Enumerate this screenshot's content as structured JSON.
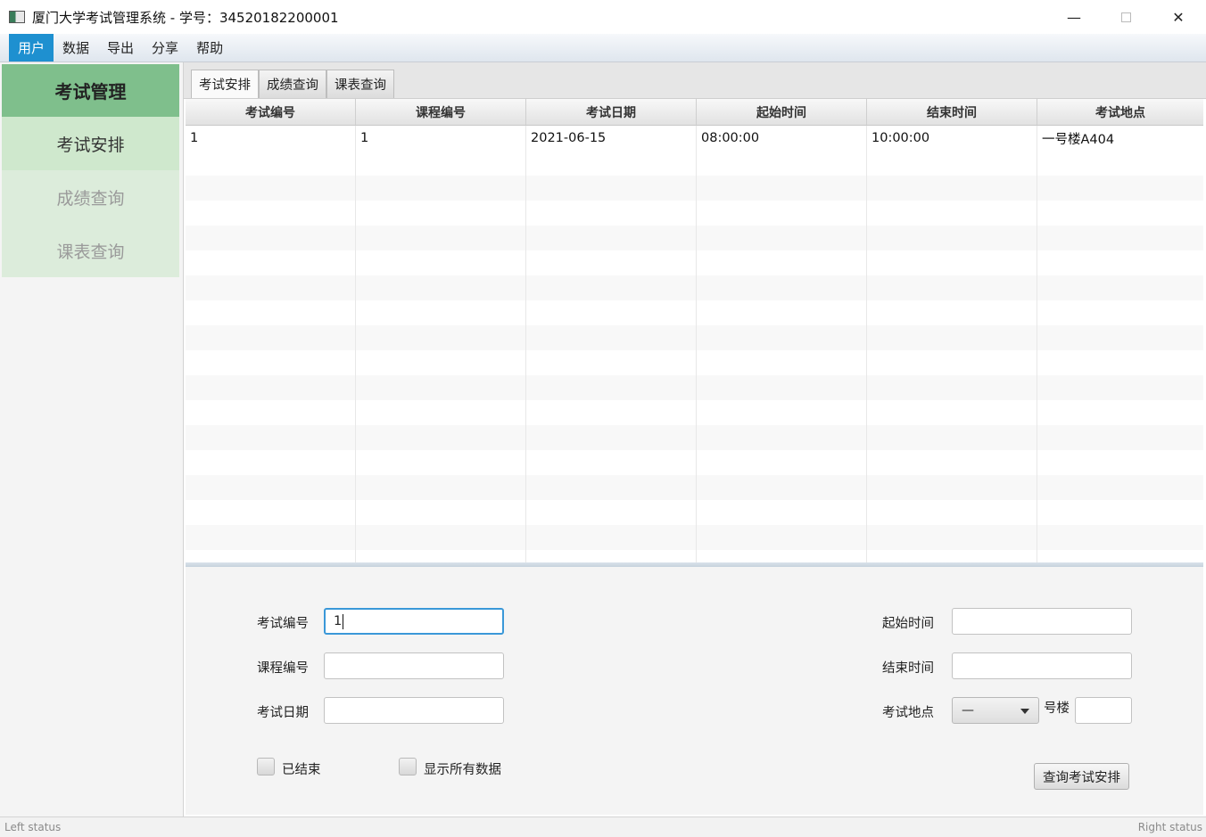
{
  "window": {
    "title": "厦门大学考试管理系统 - 学号：34520182200001"
  },
  "menu": [
    "用户",
    "数据",
    "导出",
    "分享",
    "帮助"
  ],
  "sidebar": {
    "header": "考试管理",
    "items": [
      "考试安排",
      "成绩查询",
      "课表查询"
    ]
  },
  "tabs": [
    "考试安排",
    "成绩查询",
    "课表查询"
  ],
  "table": {
    "columns": [
      "考试编号",
      "课程编号",
      "考试日期",
      "起始时间",
      "结束时间",
      "考试地点"
    ],
    "rows": [
      [
        "1",
        "1",
        "2021-06-15",
        "08:00:00",
        "10:00:00",
        "一号楼A404"
      ]
    ]
  },
  "form": {
    "exam_id_label": "考试编号",
    "exam_id_value": "1",
    "course_id_label": "课程编号",
    "course_id_value": "",
    "exam_date_label": "考试日期",
    "exam_date_value": "",
    "start_time_label": "起始时间",
    "start_time_value": "",
    "end_time_label": "结束时间",
    "end_time_value": "",
    "location_label": "考试地点",
    "building_value": "—",
    "building_suffix": "号楼",
    "room_value": "",
    "ended_label": "已结束",
    "show_all_label": "显示所有数据",
    "query_button": "查询考试安排"
  },
  "status": {
    "left": "Left status",
    "right": "Right status"
  },
  "colors": {
    "accent": "#1e90d0",
    "sidebar_header": "#7fbf8c",
    "sidebar_active": "#cfe8cd",
    "focus": "#3a98d8"
  }
}
